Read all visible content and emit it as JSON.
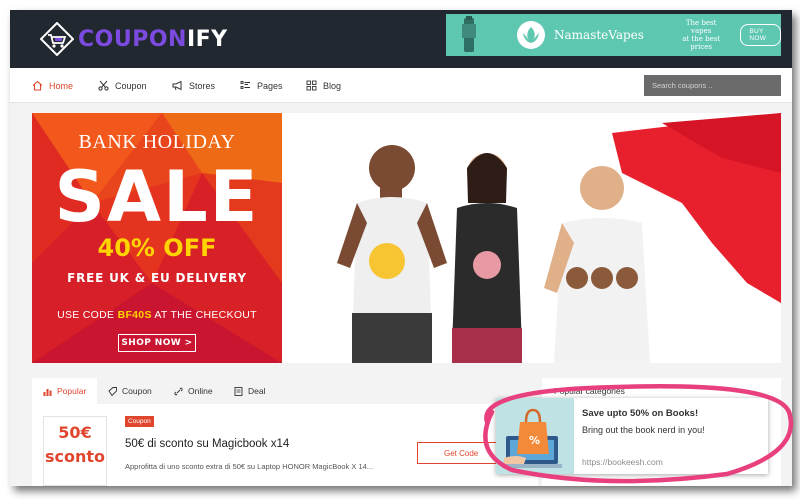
{
  "header": {
    "logo_part1": "COUPON",
    "logo_part2": "IFY",
    "ad": {
      "brand": "NamasteVapes",
      "tagline_1": "The best vapes",
      "tagline_2": "at the best prices",
      "cta": "BUY NOW",
      "color": "#5ec7b0"
    }
  },
  "nav": {
    "items": [
      {
        "label": "Home",
        "icon": "home-icon"
      },
      {
        "label": "Coupon",
        "icon": "scissors-icon"
      },
      {
        "label": "Stores",
        "icon": "megaphone-icon"
      },
      {
        "label": "Pages",
        "icon": "list-icon"
      },
      {
        "label": "Blog",
        "icon": "grid-icon"
      }
    ],
    "search_placeholder": "Search coupons ..",
    "accent": "#e0462e"
  },
  "banner": {
    "line1": "BANK HOLIDAY",
    "line2": "SALE",
    "line3": "40% OFF",
    "line4": "FREE UK & EU DELIVERY",
    "code_prefix": "USE CODE ",
    "code": "BF40S",
    "code_suffix": " AT THE CHECKOUT",
    "cta": "SHOP NOW >"
  },
  "tabs": [
    {
      "label": "Popular",
      "icon": "bar-chart-icon"
    },
    {
      "label": "Coupon",
      "icon": "tag-icon"
    },
    {
      "label": "Online",
      "icon": "link-icon"
    },
    {
      "label": "Deal",
      "icon": "document-icon"
    }
  ],
  "deal": {
    "box_value": "50€",
    "box_label": "sconto",
    "badge": "Coupon",
    "title": "50€ di sconto su Magicbook x14",
    "description": "Approfitta di uno sconto extra di 50€ su Laptop HONOR MagicBook X 14...",
    "button": "Get Code"
  },
  "sidebar": {
    "title": "Popular categories"
  },
  "popup": {
    "title": "Save upto 50% on Books!",
    "subtitle": "Bring out the book nerd in you!",
    "url": "https://bookeesh.com",
    "image_icon": "shopping-bag-laptop-icon",
    "ring_color": "#e8407e"
  }
}
